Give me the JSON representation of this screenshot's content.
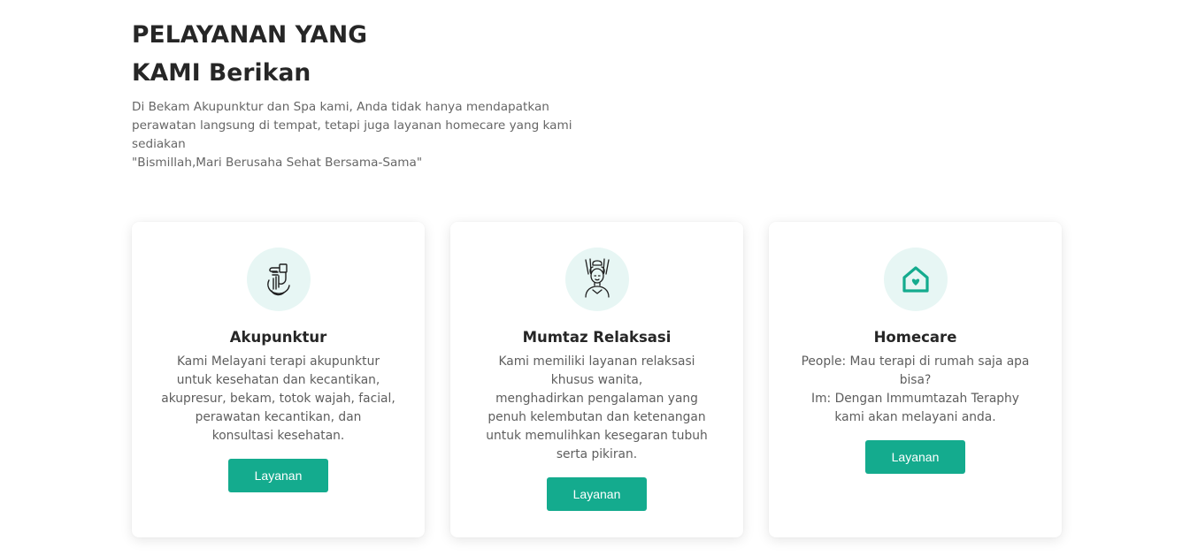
{
  "section": {
    "title_line1": "PELAYANAN YANG",
    "title_line2": "KAMI Berikan",
    "description": "Di Bekam Akupunktur dan Spa kami, Anda tidak hanya mendapatkan\nperawatan langsung di tempat, tetapi juga layanan homecare yang kami\nsediakan\n\"Bismillah,Mari Berusaha Sehat Bersama-Sama\""
  },
  "colors": {
    "accent": "#14ab8e",
    "icon_bg": "#e7f6f4"
  },
  "cards": [
    {
      "icon": "acupuncture-hand-icon",
      "title": "Akupunktur",
      "text": "Kami Melayani terapi akupunktur\nuntuk kesehatan dan kecantikan,\nakupresur, bekam, totok wajah, facial,\nperawatan kecantikan, dan\nkonsultasi kesehatan.",
      "button": "Layanan"
    },
    {
      "icon": "massage-face-icon",
      "title": "Mumtaz Relaksasi",
      "text": "Kami memiliki layanan relaksasi\nkhusus wanita,\nmenghadirkan pengalaman yang\npenuh kelembutan dan ketenangan\nuntuk memulihkan kesegaran tubuh\nserta pikiran.",
      "button": "Layanan"
    },
    {
      "icon": "home-heart-icon",
      "title": "Homecare",
      "text": "People: Mau terapi di rumah saja apa\nbisa?\nIm: Dengan Immumtazah Teraphy\nkami akan melayani anda.",
      "button": "Layanan"
    }
  ]
}
